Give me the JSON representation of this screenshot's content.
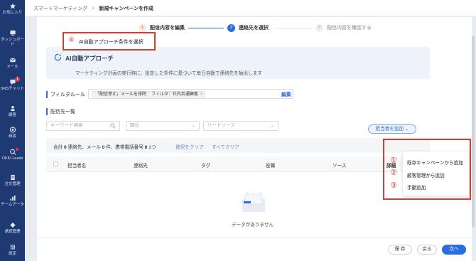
{
  "sidebar": {
    "items": [
      {
        "label": "お気に入り",
        "icon": "star-icon"
      },
      {
        "label": "ダッシュボード",
        "icon": "monitor-icon"
      },
      {
        "label": "メール",
        "icon": "mail-icon"
      },
      {
        "label": "SNSチャット",
        "icon": "chat-icon",
        "badge": "1"
      },
      {
        "label": "顧客",
        "icon": "people-icon"
      },
      {
        "label": "商談",
        "icon": "target-icon"
      },
      {
        "label": "OKKI Leads",
        "icon": "leads-icon"
      },
      {
        "label": "注文管理",
        "icon": "document-icon"
      },
      {
        "label": "チームデータ",
        "icon": "chart-icon"
      },
      {
        "label": "承認管理",
        "icon": "approval-icon"
      },
      {
        "label": "設定",
        "icon": "settings-icon"
      }
    ]
  },
  "breadcrumb": {
    "parent": "スマートマーケティング",
    "separator": ">",
    "current": "新規キャンペーンを作成"
  },
  "steps": [
    {
      "num": "1",
      "label": "配信内容を編集"
    },
    {
      "num": "2",
      "label": "連絡先を選択"
    },
    {
      "num": "3",
      "label": "配信内容を確認する"
    }
  ],
  "ai_card": {
    "title": "AI自動アプローチ",
    "description": "マーケティング計画の実行時に、設定した条件に基づいて毎日自動で連絡先を抽出します",
    "callout_num": "④",
    "callout_text": "AI自動アプローチ条件を選択"
  },
  "filter": {
    "label": "フィルタルール",
    "chips": [
      "「配信停止」メールを排除",
      "フィルタ：社内共通顧客"
    ],
    "chip_close": "×",
    "edit_label": "編集"
  },
  "list": {
    "label": "配信先一覧",
    "search_placeholder": "キーワード検索",
    "select1_placeholder": "職位",
    "select2_placeholder": "リードソース"
  },
  "summary": {
    "prefix": "合計",
    "contacts": "0",
    "contacts_unit": "連絡先、メール",
    "emails": "0",
    "emails_unit": "件、携帯電話番号",
    "phones": "0",
    "phones_unit": "1つ",
    "clear_selection": "貫択をクリア",
    "clear_all": "すべてクリア",
    "assign_button": "担当者を追加"
  },
  "table": {
    "columns": [
      "担当者名",
      "連絡先",
      "タグ",
      "役職",
      "ソース",
      "詳細"
    ]
  },
  "empty_state": "データがありません",
  "dropdown": {
    "items": [
      {
        "num": "①",
        "label": "既存キャンペーンから追加"
      },
      {
        "num": "②",
        "label": "顧客管理から追加"
      },
      {
        "num": "③",
        "label": "手動追加"
      }
    ]
  },
  "footer": {
    "save": "保 存",
    "back": "戻る",
    "next": "次へ"
  },
  "colors": {
    "sidebar": "#1f3a72",
    "primary": "#2a6de0",
    "annotation": "#e03a2f"
  }
}
